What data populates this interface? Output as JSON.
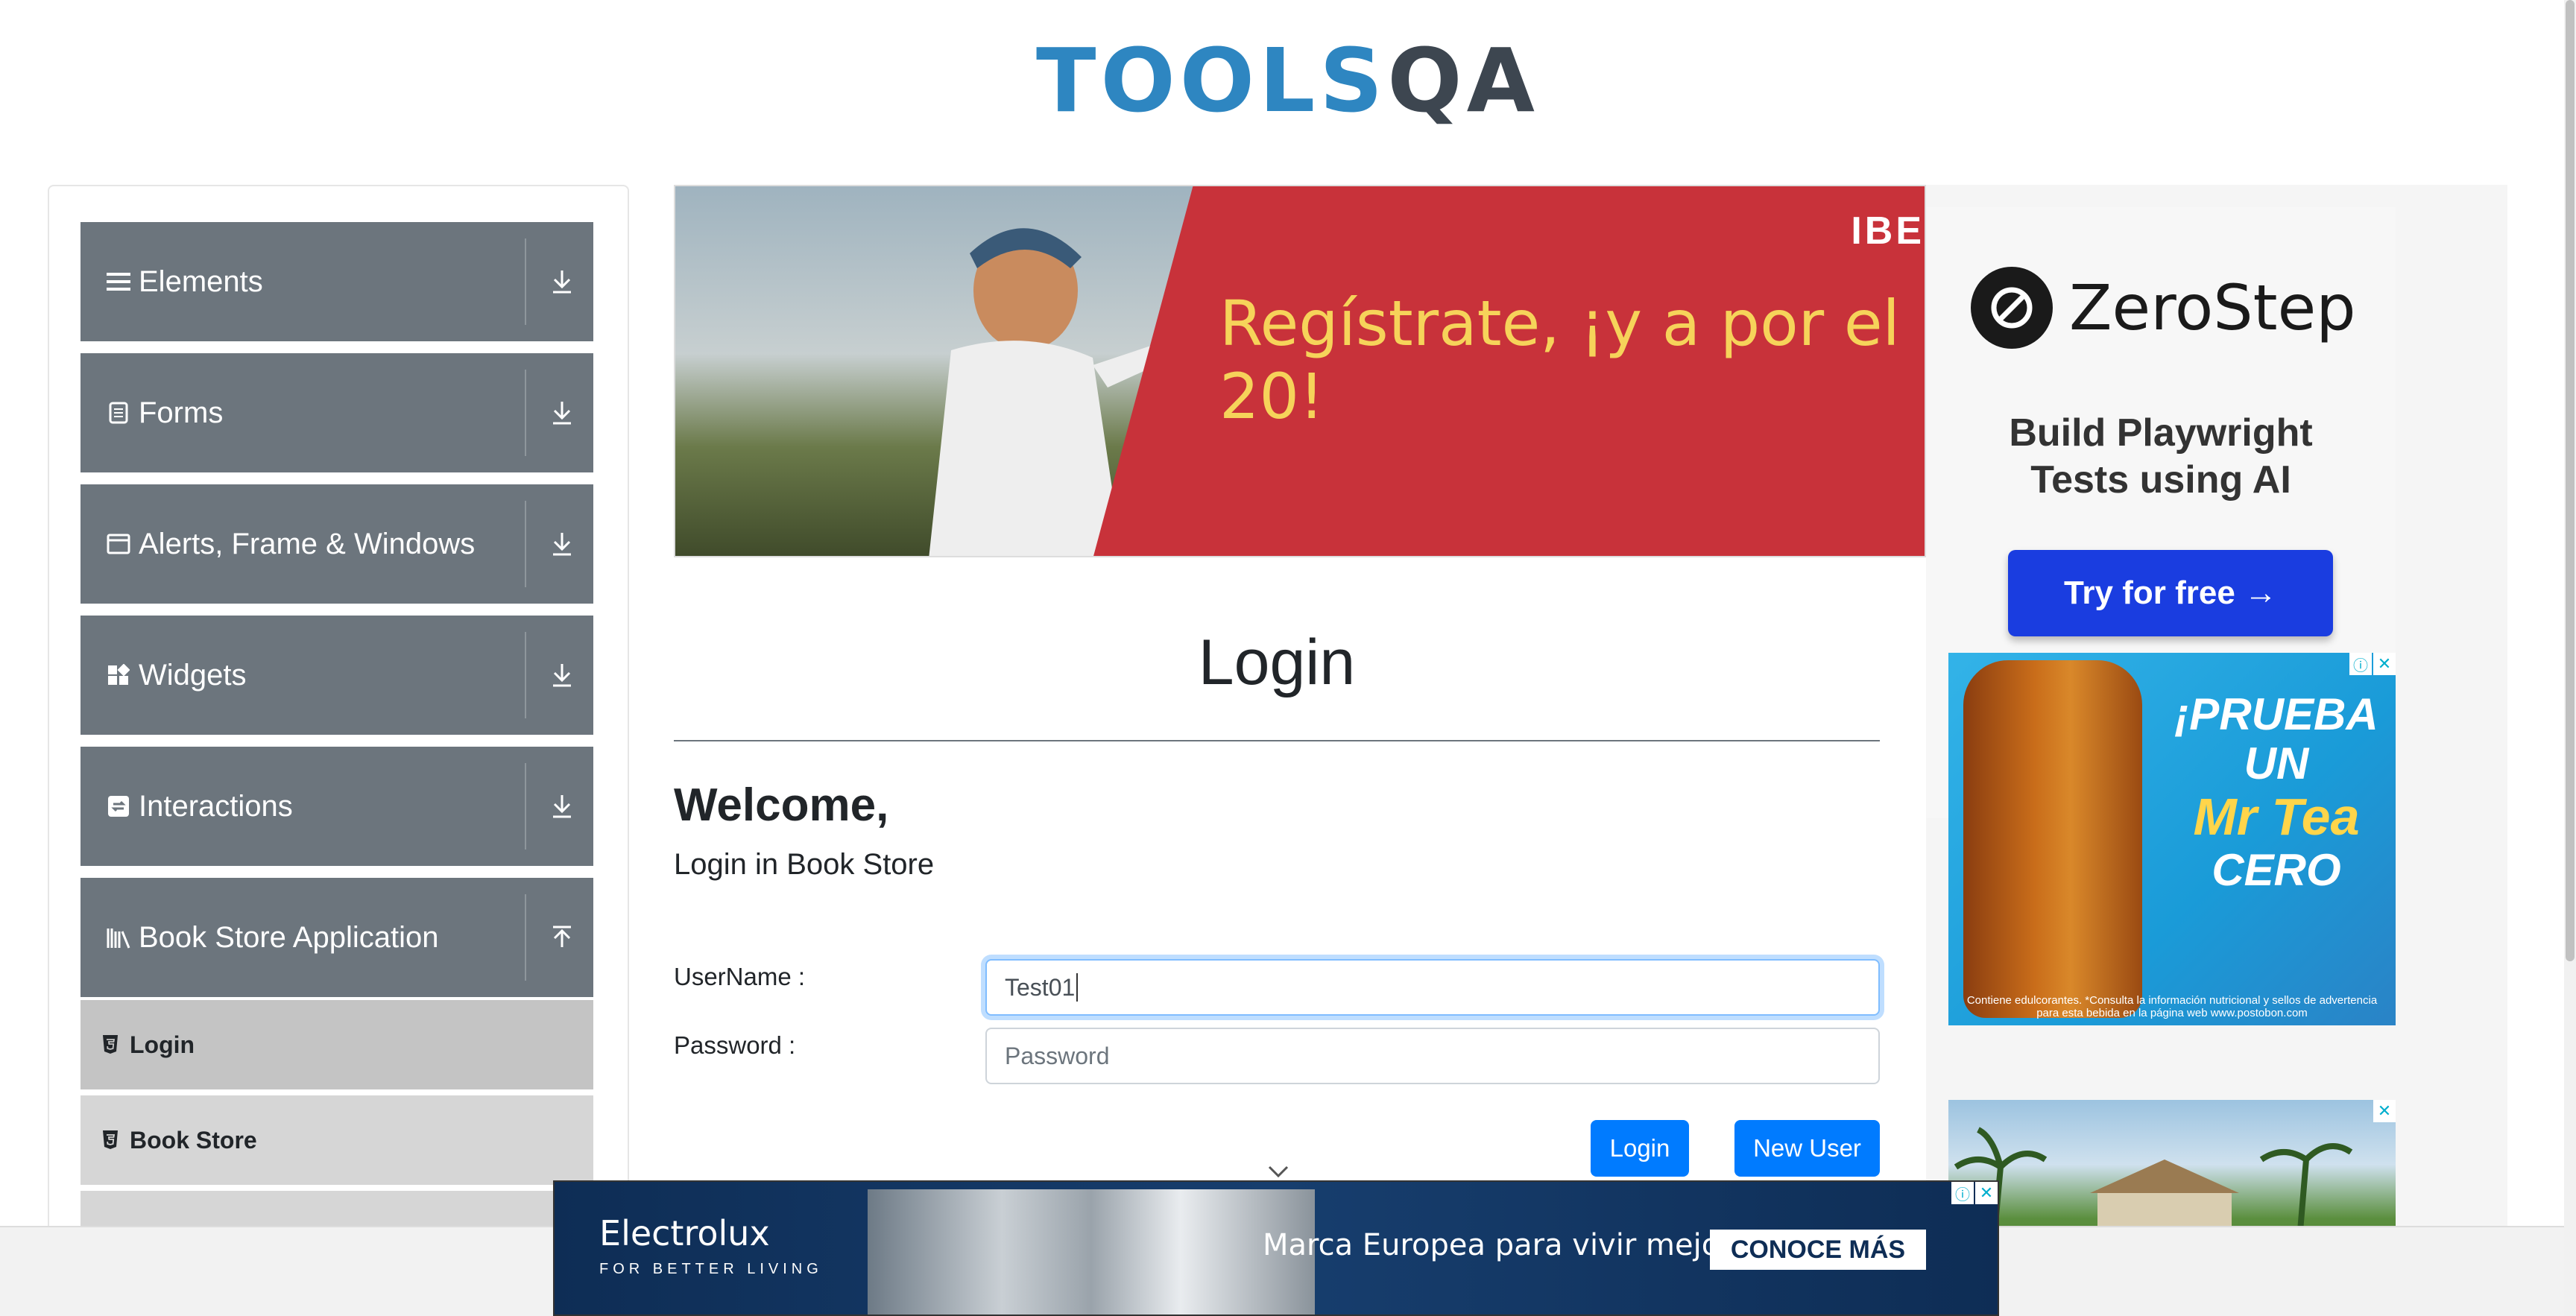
{
  "header": {
    "logo_main": "TOOLS",
    "logo_accent": "QA"
  },
  "sidebar": {
    "groups": [
      {
        "label": "Elements",
        "icon": "hamburger-icon",
        "arrow": "download-arrow-icon"
      },
      {
        "label": "Forms",
        "icon": "document-icon",
        "arrow": "download-arrow-icon"
      },
      {
        "label": "Alerts, Frame & Windows",
        "icon": "window-icon",
        "arrow": "download-arrow-icon"
      },
      {
        "label": "Widgets",
        "icon": "widgets-icon",
        "arrow": "download-arrow-icon"
      },
      {
        "label": "Interactions",
        "icon": "interactions-icon",
        "arrow": "download-arrow-icon"
      },
      {
        "label": "Book Store Application",
        "icon": "books-icon",
        "arrow": "upload-arrow-icon"
      }
    ],
    "subitems": [
      {
        "label": "Login",
        "active": true
      },
      {
        "label": "Book Store",
        "active": false
      }
    ]
  },
  "banner": {
    "brand": "IBE",
    "slogan": "Regístrate, ¡y a por el 20!"
  },
  "main": {
    "title": "Login",
    "welcome": "Welcome,",
    "subtitle": "Login in Book Store",
    "username_label": "UserName :",
    "username_value": "Test01",
    "password_label": "Password :",
    "password_placeholder": "Password",
    "login_button": "Login",
    "new_user_button": "New User"
  },
  "ads": {
    "zerostep": {
      "name": "ZeroStep",
      "tagline_line1": "Build Playwright",
      "tagline_line2": "Tests using AI",
      "cta": "Try for free →"
    },
    "tea": {
      "headline": "¡PRUEBA UN",
      "brand": "Mr Tea",
      "suffix": "CERO",
      "fine_print": "Contiene edulcorantes. *Consulta la información nutricional y sellos de advertencia para esta bebida en la página web www.postobon.com"
    },
    "electrolux": {
      "name": "Electrolux",
      "tagline": "FOR BETTER LIVING",
      "message": "Marca Europea para vivir mejor",
      "cta": "CONOCE MÁS"
    }
  },
  "colors": {
    "sidebar_group": "#6c757d",
    "sidebar_sub": "#d6d6d6",
    "primary_button": "#007bff",
    "logo_blue": "#2e86c1",
    "zerostep_button": "#1a3de0"
  }
}
